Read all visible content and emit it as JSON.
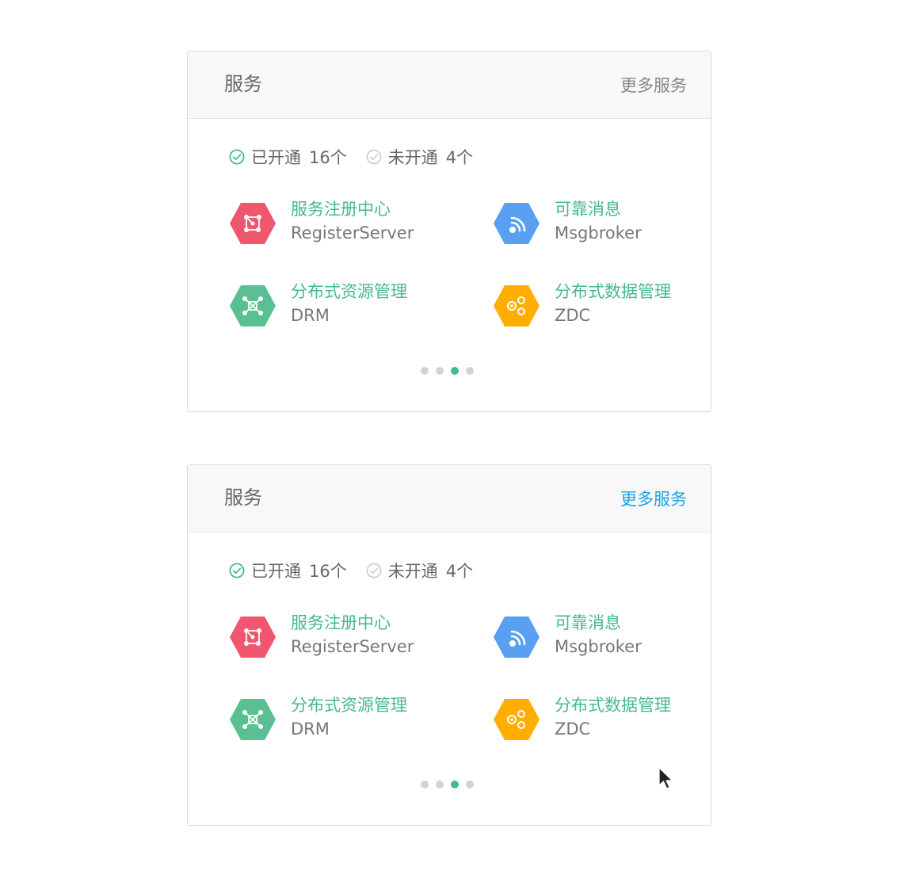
{
  "colors": {
    "accent_green": "#46b98c",
    "link_blue": "#1aa3e6",
    "red": "#f0576f",
    "blue": "#5aa0f2",
    "green": "#5bbf94",
    "orange": "#ffae00"
  },
  "cards": [
    {
      "title": "服务",
      "more_label": "更多服务",
      "more_state": "default",
      "status": {
        "enabled_label": "已开通",
        "enabled_count": "16个",
        "disabled_label": "未开通",
        "disabled_count": "4个"
      },
      "services": [
        {
          "name": "服务注册中心",
          "code": "RegisterServer",
          "icon": "register-server-icon",
          "color": "#f0576f"
        },
        {
          "name": "可靠消息",
          "code": "Msgbroker",
          "icon": "msgbroker-icon",
          "color": "#5aa0f2"
        },
        {
          "name": "分布式资源管理",
          "code": "DRM",
          "icon": "drm-icon",
          "color": "#5bbf94"
        },
        {
          "name": "分布式数据管理",
          "code": "ZDC",
          "icon": "zdc-icon",
          "color": "#ffae00"
        }
      ],
      "pager": {
        "total": 4,
        "current": 3
      }
    },
    {
      "title": "服务",
      "more_label": "更多服务",
      "more_state": "hover",
      "status": {
        "enabled_label": "已开通",
        "enabled_count": "16个",
        "disabled_label": "未开通",
        "disabled_count": "4个"
      },
      "services": [
        {
          "name": "服务注册中心",
          "code": "RegisterServer",
          "icon": "register-server-icon",
          "color": "#f0576f"
        },
        {
          "name": "可靠消息",
          "code": "Msgbroker",
          "icon": "msgbroker-icon",
          "color": "#5aa0f2"
        },
        {
          "name": "分布式资源管理",
          "code": "DRM",
          "icon": "drm-icon",
          "color": "#5bbf94"
        },
        {
          "name": "分布式数据管理",
          "code": "ZDC",
          "icon": "zdc-icon",
          "color": "#ffae00"
        }
      ],
      "pager": {
        "total": 4,
        "current": 3
      }
    }
  ]
}
